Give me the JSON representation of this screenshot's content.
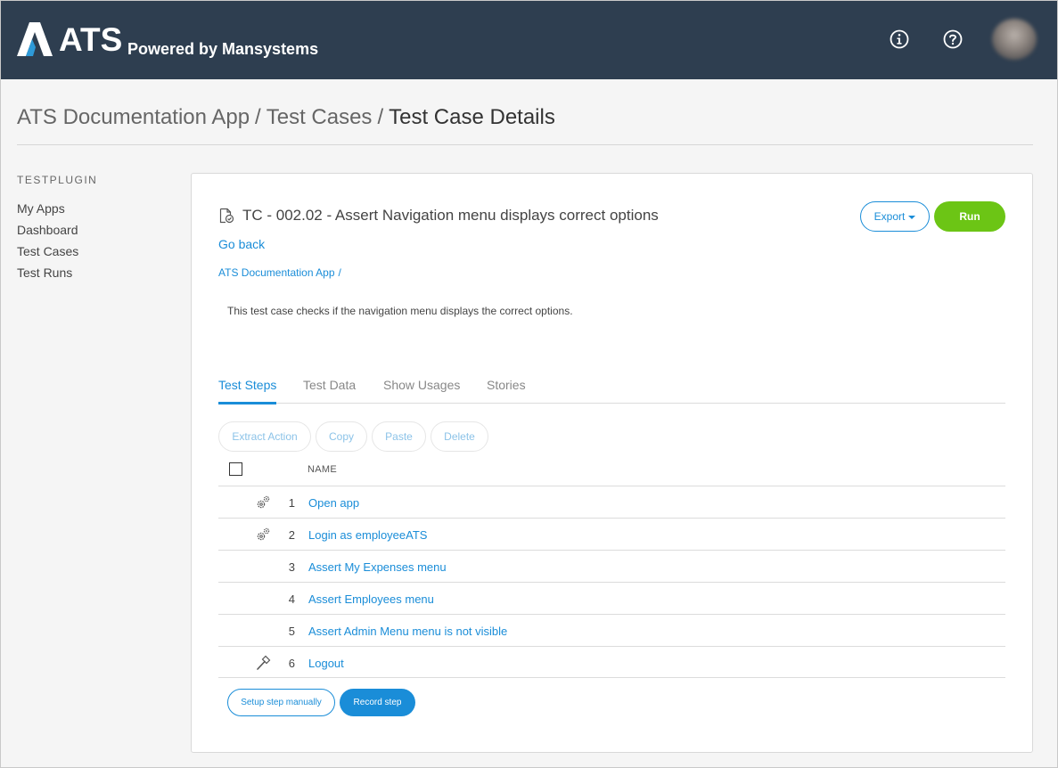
{
  "header": {
    "logo_text": "ATS",
    "logo_subtitle": "Powered by Mansystems",
    "icons": [
      "info-icon",
      "help-icon"
    ],
    "colors": {
      "bar": "#2e3e50",
      "accent": "#1a8dd8",
      "run": "#6cc515"
    }
  },
  "breadcrumb": {
    "app": "ATS Documentation App",
    "section": "Test Cases",
    "current": "Test Case Details",
    "separator": "/"
  },
  "sidebar": {
    "heading": "TESTPLUGIN",
    "items": [
      {
        "label": "My Apps"
      },
      {
        "label": "Dashboard"
      },
      {
        "label": "Test Cases"
      },
      {
        "label": "Test Runs"
      }
    ]
  },
  "testcase": {
    "title": "TC - 002.02 - Assert Navigation menu displays correct  options",
    "export_label": "Export",
    "run_label": "Run",
    "go_back": "Go back",
    "crumb": "ATS Documentation App",
    "crumb_sep": "/",
    "description": "This test case checks if the navigation menu displays the correct options."
  },
  "tabs": [
    {
      "label": "Test Steps",
      "active": true
    },
    {
      "label": "Test Data"
    },
    {
      "label": "Show Usages"
    },
    {
      "label": "Stories"
    }
  ],
  "actions": {
    "extract": "Extract Action",
    "copy": "Copy",
    "paste": "Paste",
    "delete": "Delete"
  },
  "table": {
    "column_name": "NAME",
    "rows": [
      {
        "num": "1",
        "name": "Open app",
        "icon": "gears-icon"
      },
      {
        "num": "2",
        "name": "Login as employeeATS",
        "icon": "gears-icon"
      },
      {
        "num": "3",
        "name": "Assert My Expenses menu",
        "icon": ""
      },
      {
        "num": "4",
        "name": "Assert Employees menu",
        "icon": ""
      },
      {
        "num": "5",
        "name": "Assert Admin Menu menu is not visible",
        "icon": ""
      },
      {
        "num": "6",
        "name": "Logout",
        "icon": "hammer-icon"
      }
    ]
  },
  "footer_buttons": {
    "setup": "Setup step manually",
    "record": "Record step"
  }
}
